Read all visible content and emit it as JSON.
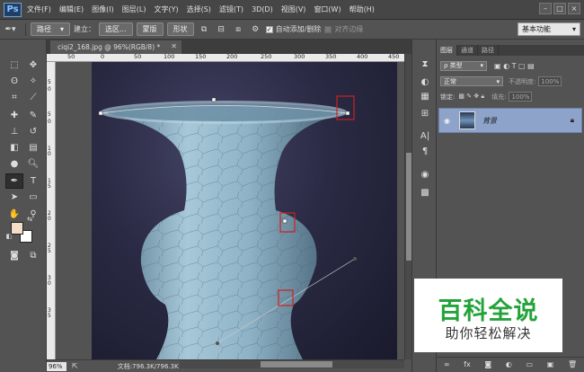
{
  "app": {
    "logo": "Ps"
  },
  "menu": [
    "文件(F)",
    "编辑(E)",
    "图像(I)",
    "图层(L)",
    "文字(Y)",
    "选择(S)",
    "滤镜(T)",
    "3D(D)",
    "视图(V)",
    "窗口(W)",
    "帮助(H)"
  ],
  "window_controls": {
    "minimize": "–",
    "maximize": "□",
    "close": "×"
  },
  "options": {
    "mode_select": "路径",
    "build_label": "建立：",
    "selection_btn": "选区...",
    "mask_btn": "蒙版",
    "shape_btn": "形状",
    "auto_add_delete": "自动添加/删除",
    "auto_add_delete_checked": true,
    "align_edges": "对齐边缘",
    "workspace": "基本功能"
  },
  "document": {
    "tab_title": "ciqi2_168.jpg @ 96%(RGB/8) *",
    "zoom": "96%",
    "info": "文档:796.3K/796.3K",
    "hruler_labels": [
      "50",
      "0",
      "50",
      "100",
      "150",
      "200",
      "250",
      "300",
      "350",
      "400",
      "450"
    ],
    "vruler_labels": [
      "5",
      "0",
      "5",
      "0",
      "1",
      "0",
      "1",
      "5",
      "2",
      "0",
      "2",
      "5",
      "3",
      "0",
      "3",
      "5"
    ]
  },
  "layers_panel": {
    "tabs": [
      "图层",
      "通道",
      "路径"
    ],
    "filter_kind": "ρ 类型",
    "blend_mode": "正常",
    "opacity_label": "不透明度:",
    "opacity_value": "100%",
    "lock_label": "锁定:",
    "fill_label": "填充:",
    "fill_value": "100%",
    "layer_name": "背景"
  },
  "watermark": {
    "title": "百科全说",
    "subtitle": "助你轻松解决"
  },
  "colors": {
    "foreground": "#f3dcc8",
    "background": "#ffffff",
    "layer_highlight": "#8ea3c9",
    "watermark_green": "#23a33a",
    "anchor_box": "#cc2222"
  }
}
